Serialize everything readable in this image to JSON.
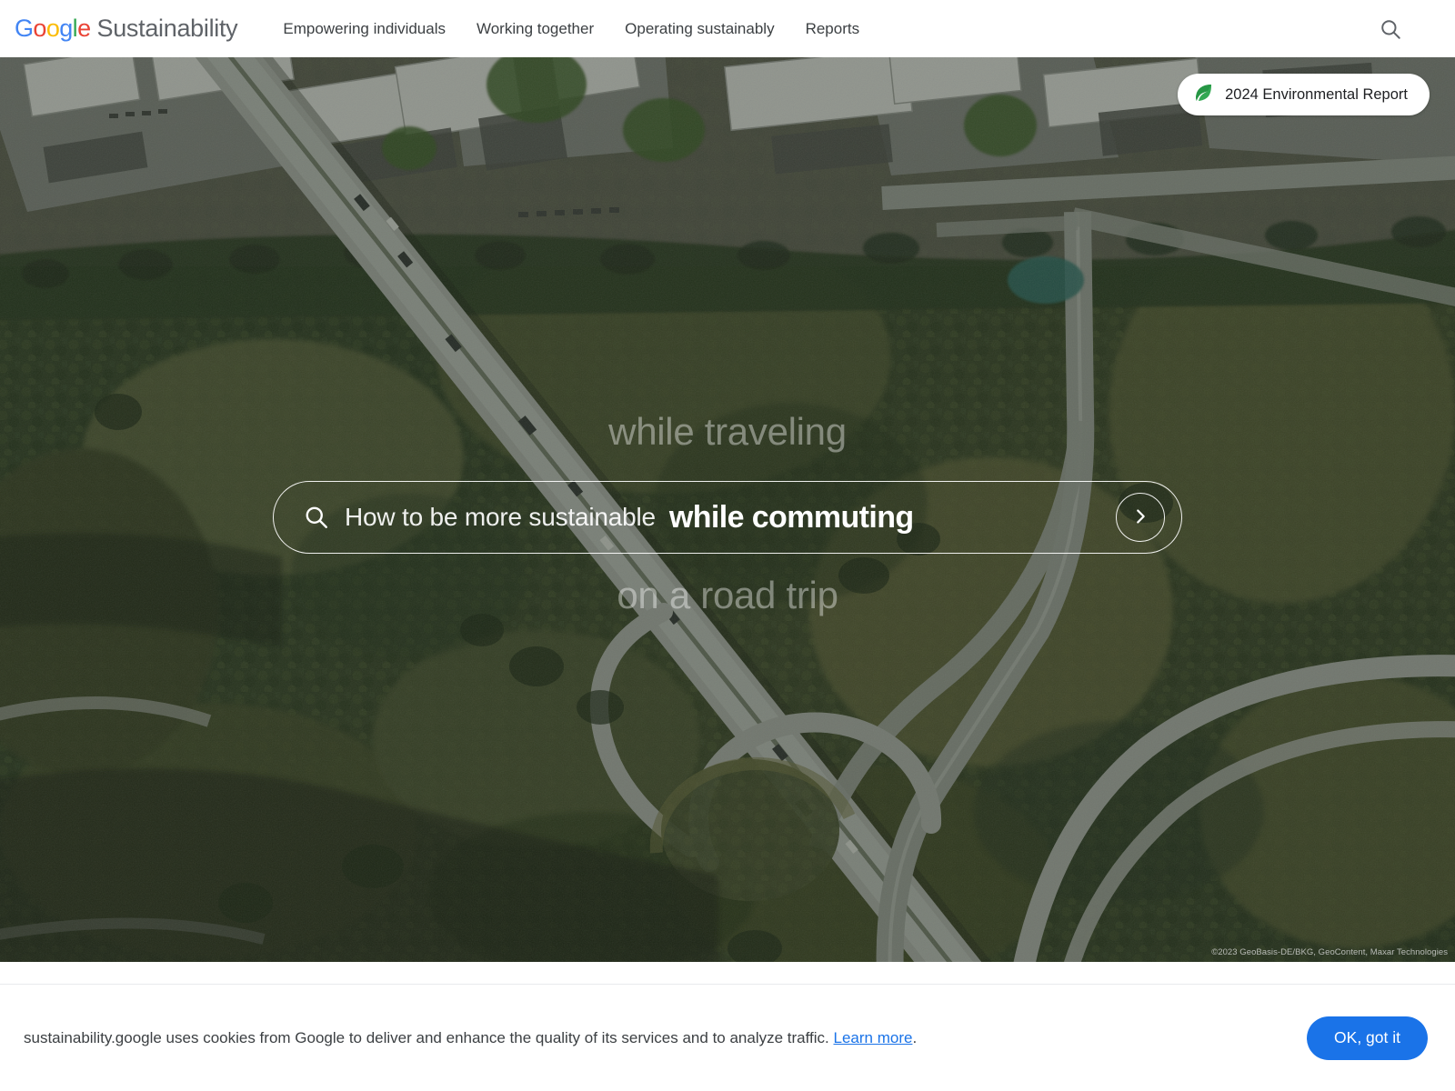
{
  "header": {
    "brand_google": "Google",
    "brand_suffix": "Sustainability",
    "nav": [
      {
        "label": "Empowering individuals"
      },
      {
        "label": "Working together"
      },
      {
        "label": "Operating sustainably"
      },
      {
        "label": "Reports"
      }
    ],
    "search_icon": "search-icon"
  },
  "hero": {
    "badge": {
      "label": "2024 Environmental Report",
      "icon": "leaf-icon",
      "leaf_color": "#34A853"
    },
    "rotator": {
      "above": "while traveling",
      "current": "while commuting",
      "below": "on a road trip"
    },
    "search": {
      "icon": "search-icon",
      "prefix": "How to be more sustainable",
      "submit_icon": "chevron-right-icon"
    },
    "attribution": "©2023 GeoBasis-DE/BKG, GeoContent, Maxar Technologies",
    "image_description": "Aerial satellite view of a highway cloverleaf interchange surrounded by forest"
  },
  "cookie_banner": {
    "text_before": "sustainability.google uses cookies from Google to deliver and enhance the quality of its services and to analyze traffic.",
    "link_label": "Learn more",
    "text_after": ".",
    "accept_label": "OK, got it",
    "accent_color": "#1a73e8"
  }
}
